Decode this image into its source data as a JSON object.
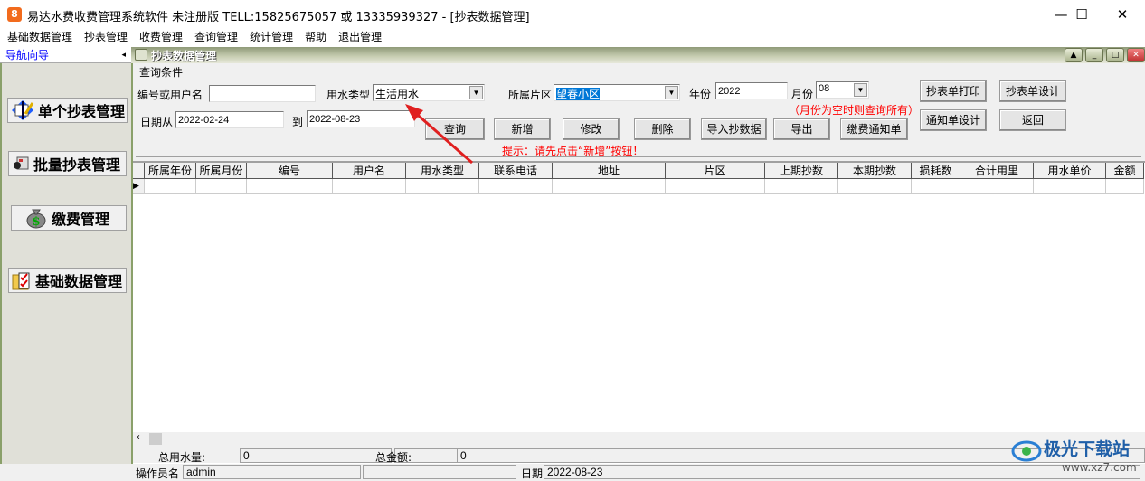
{
  "window": {
    "app_icon": "8",
    "title": "易达水费收费管理系统软件  未注册版  TELL:15825675057 或 13335939327  - [抄表数据管理]",
    "minimize": "—",
    "maximize": "☐",
    "close": "✕"
  },
  "menu": [
    "基础数据管理",
    "抄表管理",
    "收费管理",
    "查询管理",
    "统计管理",
    "帮助",
    "退出管理"
  ],
  "nav": {
    "title": "导航向导",
    "collapse": "◂",
    "buttons": [
      {
        "label": "单个抄表管理",
        "icon": "meter-reading-icon"
      },
      {
        "label": "批量抄表管理",
        "icon": "batch-icon"
      },
      {
        "label": "缴费管理",
        "icon": "money-bag-icon"
      },
      {
        "label": "基础数据管理",
        "icon": "folder-check-icon"
      }
    ]
  },
  "child": {
    "title": "抄表数据管理"
  },
  "query": {
    "legend": "查询条件",
    "id_label": "编号或用户名",
    "id_value": "",
    "water_type_label": "用水类型",
    "water_type_value": "生活用水",
    "area_label": "所属片区",
    "area_value": "望春小区",
    "year_label": "年份",
    "year_value": "2022",
    "month_label": "月份",
    "month_value": "08",
    "month_hint": "（月份为空时则查询所有）",
    "date_from_label": "日期从",
    "date_from": "2022-02-24",
    "date_to_label": "到",
    "date_to": "2022-08-23",
    "hint": "提示：请先点击“新增”按钮！",
    "buttons": {
      "query": "查询",
      "add": "新增",
      "edit": "修改",
      "delete": "删除",
      "import": "导入抄数据",
      "export": "导出",
      "notice": "缴费通知单",
      "print": "抄表单打印",
      "design": "抄表单设计",
      "notice_design": "通知单设计",
      "back": "返回"
    }
  },
  "grid": {
    "columns": [
      "所属年份",
      "所属月份",
      "编号",
      "用户名",
      "用水类型",
      "联系电话",
      "地址",
      "片区",
      "上期抄数",
      "本期抄数",
      "损耗数",
      "合计用里",
      "用水单价",
      "金额"
    ],
    "rows": []
  },
  "status": {
    "total_water_label": "总用水量:",
    "total_water": "0",
    "total_amount_label": "总金额:",
    "total_amount": "0",
    "operator_label": "操作员名",
    "operator": "admin",
    "date_label": "日期",
    "date": "2022-08-23"
  },
  "watermark": {
    "name": "极光下载站",
    "url": "www.xz7.com"
  }
}
